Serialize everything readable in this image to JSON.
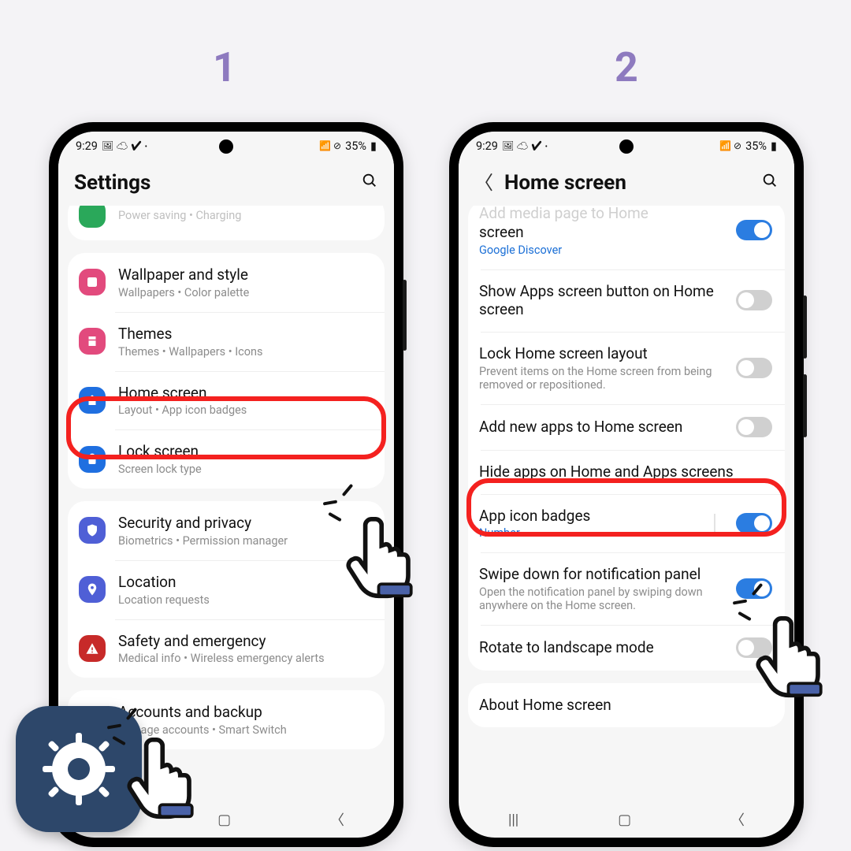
{
  "steps": {
    "one": "1",
    "two": "2"
  },
  "status": {
    "time": "9:29",
    "battery": "35%",
    "glyphs_left": "🖼 ☁ ✔",
    "glyphs_right": "📶 ⊘"
  },
  "phone1": {
    "header": {
      "title": "Settings"
    },
    "top_cut": {
      "text": "Power saving  •  Charging"
    },
    "groupA": [
      {
        "title": "Wallpaper and style",
        "sub": "Wallpapers  •  Color palette",
        "color": "#e24a7d",
        "svg": "wallpaper"
      },
      {
        "title": "Themes",
        "sub": "Themes  •  Wallpapers  •  Icons",
        "color": "#e24a7d",
        "svg": "themes"
      },
      {
        "title": "Home screen",
        "sub": "Layout  •  App icon badges",
        "color": "#1f6fe0",
        "svg": "home",
        "highlighted": true
      },
      {
        "title": "Lock screen",
        "sub": "Screen lock type",
        "color": "#1f6fe0",
        "svg": "lock"
      }
    ],
    "groupB": [
      {
        "title": "Security and privacy",
        "sub": "Biometrics  •  Permission manager",
        "color": "#4f5fd6",
        "svg": "shield"
      },
      {
        "title": "Location",
        "sub": "Location requests",
        "color": "#4f5fd6",
        "svg": "pin"
      },
      {
        "title": "Safety and emergency",
        "sub": "Medical info  •  Wireless emergency alerts",
        "color": "#c72a29",
        "svg": "alert"
      }
    ],
    "groupC": [
      {
        "title": "Accounts and backup",
        "sub": "Manage accounts  •  Smart Switch",
        "color": "#3a78b8",
        "svg": "sync"
      }
    ]
  },
  "phone2": {
    "header": {
      "title": "Home screen"
    },
    "top_item": {
      "title_cut": "Add media page to Home",
      "title_line2": "screen",
      "link": "Google Discover",
      "toggle": true
    },
    "items": [
      {
        "title": "Show Apps screen button on Home screen",
        "toggle": false
      },
      {
        "title": "Lock Home screen layout",
        "sub": "Prevent items on the Home screen from being removed or repositioned.",
        "toggle": false
      },
      {
        "title": "Add new apps to Home screen",
        "toggle": false
      },
      {
        "title": "Hide apps on Home and Apps screens",
        "highlighted": true
      },
      {
        "title": "App icon badges",
        "link": "Number",
        "toggle": true,
        "vbar": true
      },
      {
        "title": "Swipe down for notification panel",
        "sub": "Open the notification panel by swiping down anywhere on the Home screen.",
        "toggle": true
      },
      {
        "title": "Rotate to landscape mode",
        "toggle": false
      }
    ],
    "bottom_card": {
      "title": "About Home screen"
    }
  }
}
